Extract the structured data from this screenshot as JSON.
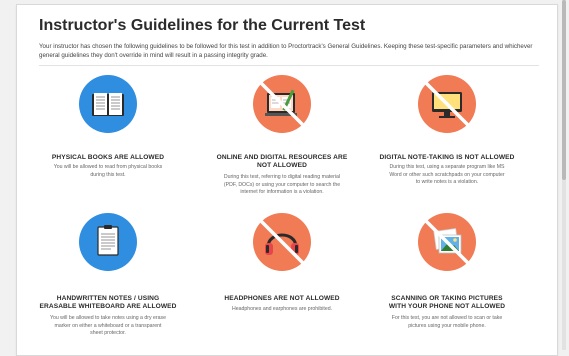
{
  "page": {
    "title": "Instructor's Guidelines for the Current Test",
    "intro": "Your instructor has chosen the following guidelines to be followed for this test in addition to Proctortrack's General Guidelines. Keeping these test-specific parameters and whichever general guidelines they don't override in mind will result in a passing integrity grade."
  },
  "colors": {
    "allowed": "#2f8ee0",
    "not_allowed": "#f07b55"
  },
  "guidelines": [
    {
      "icon": "book-icon",
      "status": "allowed",
      "title": "PHYSICAL BOOKS ARE ALLOWED",
      "description": "You will be allowed to read from physical books during this test."
    },
    {
      "icon": "digital-resources-icon",
      "status": "not_allowed",
      "title": "ONLINE AND DIGITAL RESOURCES ARE NOT ALLOWED",
      "description": "During this test, referring to digital reading material (PDF, DOCs) or using your computer to search the internet for information is a violation."
    },
    {
      "icon": "monitor-icon",
      "status": "not_allowed",
      "title": "DIGITAL NOTE-TAKING IS NOT ALLOWED",
      "description": "During this test, using a separate program like MS Word or other such scratchpads on your computer to write notes is a violation."
    },
    {
      "icon": "notepad-icon",
      "status": "allowed",
      "title": "HANDWRITTEN NOTES / USING ERASABLE WHITEBOARD ARE ALLOWED",
      "description": "You will be allowed to take notes using a dry erase marker on either a whiteboard or a transparent sheet protector."
    },
    {
      "icon": "headphones-icon",
      "status": "not_allowed",
      "title": "HEADPHONES ARE NOT ALLOWED",
      "description": "Headphones and earphones are prohibited."
    },
    {
      "icon": "camera-photo-icon",
      "status": "not_allowed",
      "title": "SCANNING OR TAKING PICTURES WITH YOUR PHONE NOT ALLOWED",
      "description": "For this test, you are not allowed to scan or take pictures using your mobile phone."
    }
  ]
}
